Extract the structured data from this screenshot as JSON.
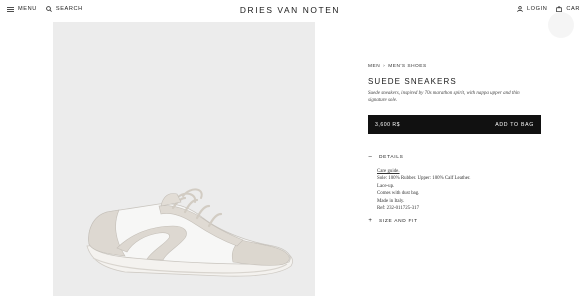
{
  "header": {
    "menu_label": "MENU",
    "search_label": "SEARCH",
    "logo": "DRIES VAN NOTEN",
    "login_label": "LOGIN",
    "cart_label": "CAR"
  },
  "product": {
    "breadcrumb": [
      "MEN",
      "MEN'S SHOES"
    ],
    "title": "SUEDE SNEAKERS",
    "description": "Suede sneakers, inspired by 70s marathon spirit, with nappa upper and thin signature sole.",
    "price": "3,600 R$",
    "add_to_bag": "ADD TO BAG"
  },
  "accordion": {
    "details_label": "DETAILS",
    "details_icon": "minus-icon",
    "care_guide": "Care guide.",
    "details_lines": [
      "Sole: 100% Rubber. Upper: 100% Calf Leather.",
      "Lace-up.",
      "Comes with dust bag.",
      "Made in Italy.",
      "Ref: 232-011725-317"
    ],
    "size_label": "SIZE AND FIT",
    "size_icon": "plus-icon"
  }
}
